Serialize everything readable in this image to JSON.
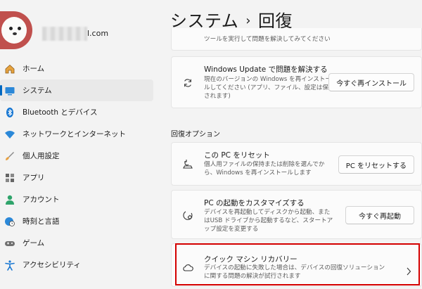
{
  "profile": {
    "email_suffix": "l.com"
  },
  "header": {
    "breadcrumb_parent": "システム",
    "breadcrumb_sep": "›",
    "breadcrumb_current": "回復"
  },
  "sidebar": {
    "items": [
      {
        "label": "ホーム",
        "icon": "home-icon"
      },
      {
        "label": "システム",
        "icon": "system-icon",
        "active": true
      },
      {
        "label": "Bluetooth とデバイス",
        "icon": "bluetooth-icon"
      },
      {
        "label": "ネットワークとインターネット",
        "icon": "wifi-icon"
      },
      {
        "label": "個人用設定",
        "icon": "brush-icon"
      },
      {
        "label": "アプリ",
        "icon": "apps-icon"
      },
      {
        "label": "アカウント",
        "icon": "account-icon"
      },
      {
        "label": "時刻と言語",
        "icon": "globe-clock-icon"
      },
      {
        "label": "ゲーム",
        "icon": "gamepad-icon"
      },
      {
        "label": "アクセシビリティ",
        "icon": "accessibility-icon"
      }
    ]
  },
  "main": {
    "top_card": {
      "desc": "ツールを実行して問題を解決してみてください"
    },
    "windows_update": {
      "title": "Windows Update で問題を解決する",
      "desc": "現在のバージョンの Windows を再インストールしてください (アプリ、ファイル、設定は保存されます)",
      "button": "今すぐ再インストール"
    },
    "section_label": "回復オプション",
    "reset_pc": {
      "title": "この PC をリセット",
      "desc": "個人用ファイルの保持または削除を選んでから、Windows を再インストールします",
      "button": "PC をリセットする"
    },
    "custom_startup": {
      "title": "PC の起動をカスタマイズする",
      "desc": "デバイスを再起動してディスクから起動、またはUSB ドライブから起動するなど、スタートアップ設定を変更する",
      "button": "今すぐ再起動"
    },
    "quick_recovery": {
      "title": "クイック マシン リカバリー",
      "desc": "デバイスの起動に失敗した場合は、デバイスの回復ソリューションに関する問題の解決が試行されます"
    }
  },
  "colors": {
    "accent": "#0067c0",
    "highlight": "#d40000"
  }
}
